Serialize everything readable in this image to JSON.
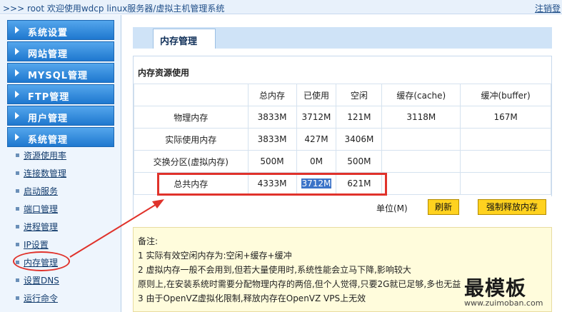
{
  "header": {
    "title": ">>> root 欢迎使用wdcp linux服务器/虚拟主机管理系统",
    "logout": "注销登"
  },
  "sidebar": {
    "menus": [
      "系统设置",
      "网站管理",
      "MYSQL管理",
      "FTP管理",
      "用户管理",
      "系统管理"
    ],
    "sub_items": [
      "资源使用率",
      "连接数管理",
      "启动服务",
      "端口管理",
      "进程管理",
      "IP设置",
      "内存管理",
      "设置DNS",
      "运行命令",
      "..."
    ]
  },
  "tab": {
    "label": "内存管理"
  },
  "panel": {
    "title": "内存资源使用",
    "columns": [
      "",
      "总内存",
      "已使用",
      "空闲",
      "缓存(cache)",
      "缓冲(buffer)"
    ],
    "rows": [
      [
        "物理内存",
        "3833M",
        "3712M",
        "121M",
        "3118M",
        "167M"
      ],
      [
        "实际使用内存",
        "3833M",
        "427M",
        "3406M",
        "",
        ""
      ],
      [
        "交换分区(虚拟内存)",
        "500M",
        "0M",
        "500M",
        "",
        ""
      ],
      [
        "总共内存",
        "4333M",
        "3712M",
        "621M",
        "",
        ""
      ]
    ],
    "unit_label": "单位(M)",
    "refresh_button": "刷新",
    "release_button": "强制释放内存"
  },
  "notes": {
    "lines": [
      "备注:",
      "1 实际有效空闲内存为:空闲+缓存+缓冲",
      "2 虚拟内存一般不会用到,但若大量使用时,系统性能会立马下降,影响较大",
      "原则上,在安装系统时需要分配物理内存的两倍,但个人觉得,只要2G就已足够,多也无益",
      "3 由于OpenVZ虚拟化限制,释放内存在OpenVZ VPS上无效"
    ]
  },
  "watermark": {
    "text": "最模板",
    "sub": "www.zuimoban.com"
  },
  "colors": {
    "accent": "#1f78cf",
    "highlight": "#e0322b",
    "button": "#ffd21f"
  }
}
